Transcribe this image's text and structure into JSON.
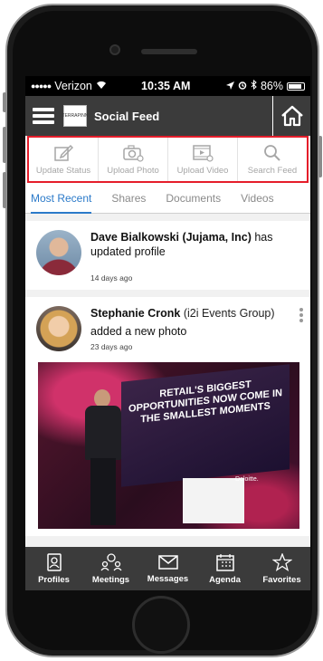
{
  "status_bar": {
    "signal_dots": "●●●●●",
    "carrier": "Verizon",
    "time": "10:35 AM",
    "battery": "86%",
    "battery_level": 0.86
  },
  "navbar": {
    "title": "Social Feed",
    "logo_text": "TERRAPINN"
  },
  "actions": [
    {
      "label": "Update Status",
      "icon": "edit-icon"
    },
    {
      "label": "Upload Photo",
      "icon": "camera-icon"
    },
    {
      "label": "Upload Video",
      "icon": "video-icon"
    },
    {
      "label": "Search Feed",
      "icon": "search-icon"
    }
  ],
  "tabs": [
    {
      "label": "Most Recent",
      "active": true
    },
    {
      "label": "Shares",
      "active": false
    },
    {
      "label": "Documents",
      "active": false
    },
    {
      "label": "Videos",
      "active": false
    }
  ],
  "feed": [
    {
      "name": "Dave Bialkowski (Jujama, Inc)",
      "action": "has updated profile",
      "time": "14 days ago"
    },
    {
      "name": "Stephanie Cronk",
      "affiliation": "(i2i Events Group)",
      "action": "added a new photo",
      "time": "23 days ago",
      "photo_text": "RETAIL'S BIGGEST OPPORTUNITIES NOW COME IN THE SMALLEST MOMENTS",
      "podium_logo": "Deloitte."
    }
  ],
  "bottom_nav": [
    {
      "label": "Profiles",
      "icon": "profile-icon"
    },
    {
      "label": "Meetings",
      "icon": "meetings-icon"
    },
    {
      "label": "Messages",
      "icon": "envelope-icon"
    },
    {
      "label": "Agenda",
      "icon": "calendar-icon"
    },
    {
      "label": "Favorites",
      "icon": "star-icon"
    }
  ],
  "colors": {
    "bar": "#3b3b3b",
    "accent": "#2b7ac9",
    "highlight_border": "#e51d2a"
  }
}
